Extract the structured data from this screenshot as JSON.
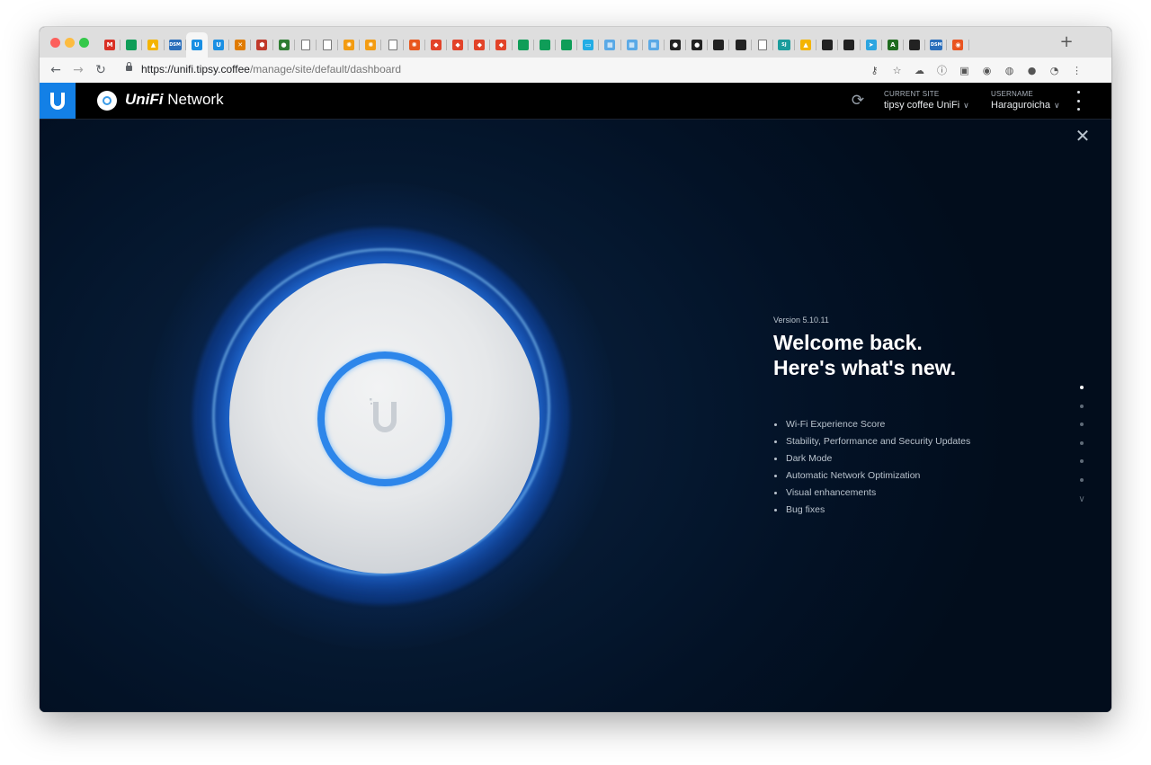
{
  "browser": {
    "tabs": [
      {
        "icon": "gmail-icon",
        "glyph": "M",
        "color": "#d93025",
        "active": false
      },
      {
        "icon": "google-sheets-icon",
        "glyph": "",
        "color": "#0f9d58",
        "active": false
      },
      {
        "icon": "google-drive-icon",
        "glyph": "▲",
        "color": "#f4b400",
        "active": false
      },
      {
        "icon": "dsm-icon",
        "glyph": "DSM",
        "color": "#2a6ebb",
        "active": false
      },
      {
        "icon": "unifi-icon",
        "glyph": "U",
        "color": "#1a8fe3",
        "active": true
      },
      {
        "icon": "unifi-icon",
        "glyph": "U",
        "color": "#1a8fe3",
        "active": false
      },
      {
        "icon": "x-icon",
        "glyph": "✕",
        "color": "#e07b00",
        "active": false
      },
      {
        "icon": "app-icon",
        "glyph": "⬢",
        "color": "#c0392b",
        "active": false
      },
      {
        "icon": "record-icon",
        "glyph": "●",
        "color": "#2e7d32",
        "active": false
      },
      {
        "icon": "document-icon",
        "glyph": "",
        "color": "doc",
        "active": false
      },
      {
        "icon": "document-icon",
        "glyph": "",
        "color": "doc",
        "active": false
      },
      {
        "icon": "grafana-icon",
        "glyph": "✺",
        "color": "#f39c12",
        "active": false
      },
      {
        "icon": "grafana-icon",
        "glyph": "✺",
        "color": "#f39c12",
        "active": false
      },
      {
        "icon": "document-icon",
        "glyph": "",
        "color": "doc",
        "active": false
      },
      {
        "icon": "grafana-icon",
        "glyph": "✺",
        "color": "#e8571e",
        "active": false
      },
      {
        "icon": "gitlab-icon",
        "glyph": "◆",
        "color": "#e24329",
        "active": false
      },
      {
        "icon": "gitlab-icon",
        "glyph": "◆",
        "color": "#e24329",
        "active": false
      },
      {
        "icon": "gitlab-icon",
        "glyph": "◆",
        "color": "#e24329",
        "active": false
      },
      {
        "icon": "gitlab-icon",
        "glyph": "◆",
        "color": "#e24329",
        "active": false
      },
      {
        "icon": "google-sheets-icon",
        "glyph": "",
        "color": "#0f9d58",
        "active": false
      },
      {
        "icon": "google-sheets-icon",
        "glyph": "",
        "color": "#0f9d58",
        "active": false
      },
      {
        "icon": "google-sheets-icon",
        "glyph": "",
        "color": "#0f9d58",
        "active": false
      },
      {
        "icon": "bilibili-icon",
        "glyph": "▭",
        "color": "#23ade5",
        "active": false
      },
      {
        "icon": "calendar-icon",
        "glyph": "▦",
        "color": "#5aa9e6",
        "active": false
      },
      {
        "icon": "calendar-icon",
        "glyph": "▦",
        "color": "#5aa9e6",
        "active": false
      },
      {
        "icon": "calendar-icon",
        "glyph": "▦",
        "color": "#5aa9e6",
        "active": false
      },
      {
        "icon": "github-icon",
        "glyph": "●",
        "color": "#222222",
        "active": false
      },
      {
        "icon": "github-icon",
        "glyph": "●",
        "color": "#222222",
        "active": false
      },
      {
        "icon": "file-icon",
        "glyph": "",
        "color": "#222222",
        "active": false
      },
      {
        "icon": "file-icon",
        "glyph": "",
        "color": "#222222",
        "active": false
      },
      {
        "icon": "document-icon",
        "glyph": "",
        "color": "doc",
        "active": false
      },
      {
        "icon": "sj-icon",
        "glyph": "SJ",
        "color": "#1a9c9c",
        "active": false
      },
      {
        "icon": "google-drive-icon",
        "glyph": "▲",
        "color": "#f4b400",
        "active": false
      },
      {
        "icon": "file-icon",
        "glyph": "",
        "color": "#222222",
        "active": false
      },
      {
        "icon": "file-icon",
        "glyph": "",
        "color": "#222222",
        "active": false
      },
      {
        "icon": "telegram-icon",
        "glyph": "➤",
        "color": "#2ca5e0",
        "active": false
      },
      {
        "icon": "terminal-icon",
        "glyph": "A",
        "color": "#1e6b1e",
        "active": false
      },
      {
        "icon": "file-icon",
        "glyph": "",
        "color": "#222222",
        "active": false
      },
      {
        "icon": "dsm-icon",
        "glyph": "DSM",
        "color": "#2a6ebb",
        "active": false
      },
      {
        "icon": "ubuntu-icon",
        "glyph": "◉",
        "color": "#e95420",
        "active": false
      }
    ],
    "url_host": "https://unifi.tipsy.coffee",
    "url_path": "/manage/site/default/dashboard",
    "toolbar_icons": [
      {
        "name": "key-icon",
        "glyph": "⚷"
      },
      {
        "name": "bookmark-star-icon",
        "glyph": "☆"
      },
      {
        "name": "cloud-extension-icon",
        "glyph": "☁"
      },
      {
        "name": "info-extension-icon",
        "glyph": "ⓘ"
      },
      {
        "name": "square-extension-icon",
        "glyph": "▣"
      },
      {
        "name": "red-extension-icon",
        "glyph": "◉"
      },
      {
        "name": "orange-extension-icon",
        "glyph": "◍"
      },
      {
        "name": "dark-extension-icon",
        "glyph": "●"
      },
      {
        "name": "profile-extension-icon",
        "glyph": "◔"
      },
      {
        "name": "chrome-menu-icon",
        "glyph": "⋮"
      }
    ]
  },
  "app": {
    "brand_bold": "UniFi",
    "brand_rest": " Network",
    "current_site_label": "CURRENT SITE",
    "current_site_value": "tipsy coffee UniFi",
    "username_label": "USERNAME",
    "username_value": "Haraguroicha",
    "accent": "#1380e6"
  },
  "whats_new": {
    "version": "Version 5.10.11",
    "headline_line1": "Welcome back.",
    "headline_line2": "Here's what's new.",
    "features": [
      "Wi-Fi Experience Score",
      "Stability, Performance and Security Updates",
      "Dark Mode",
      "Automatic Network Optimization",
      "Visual enhancements",
      "Bug fixes"
    ],
    "slides_total": 6,
    "slide_active": 1
  }
}
